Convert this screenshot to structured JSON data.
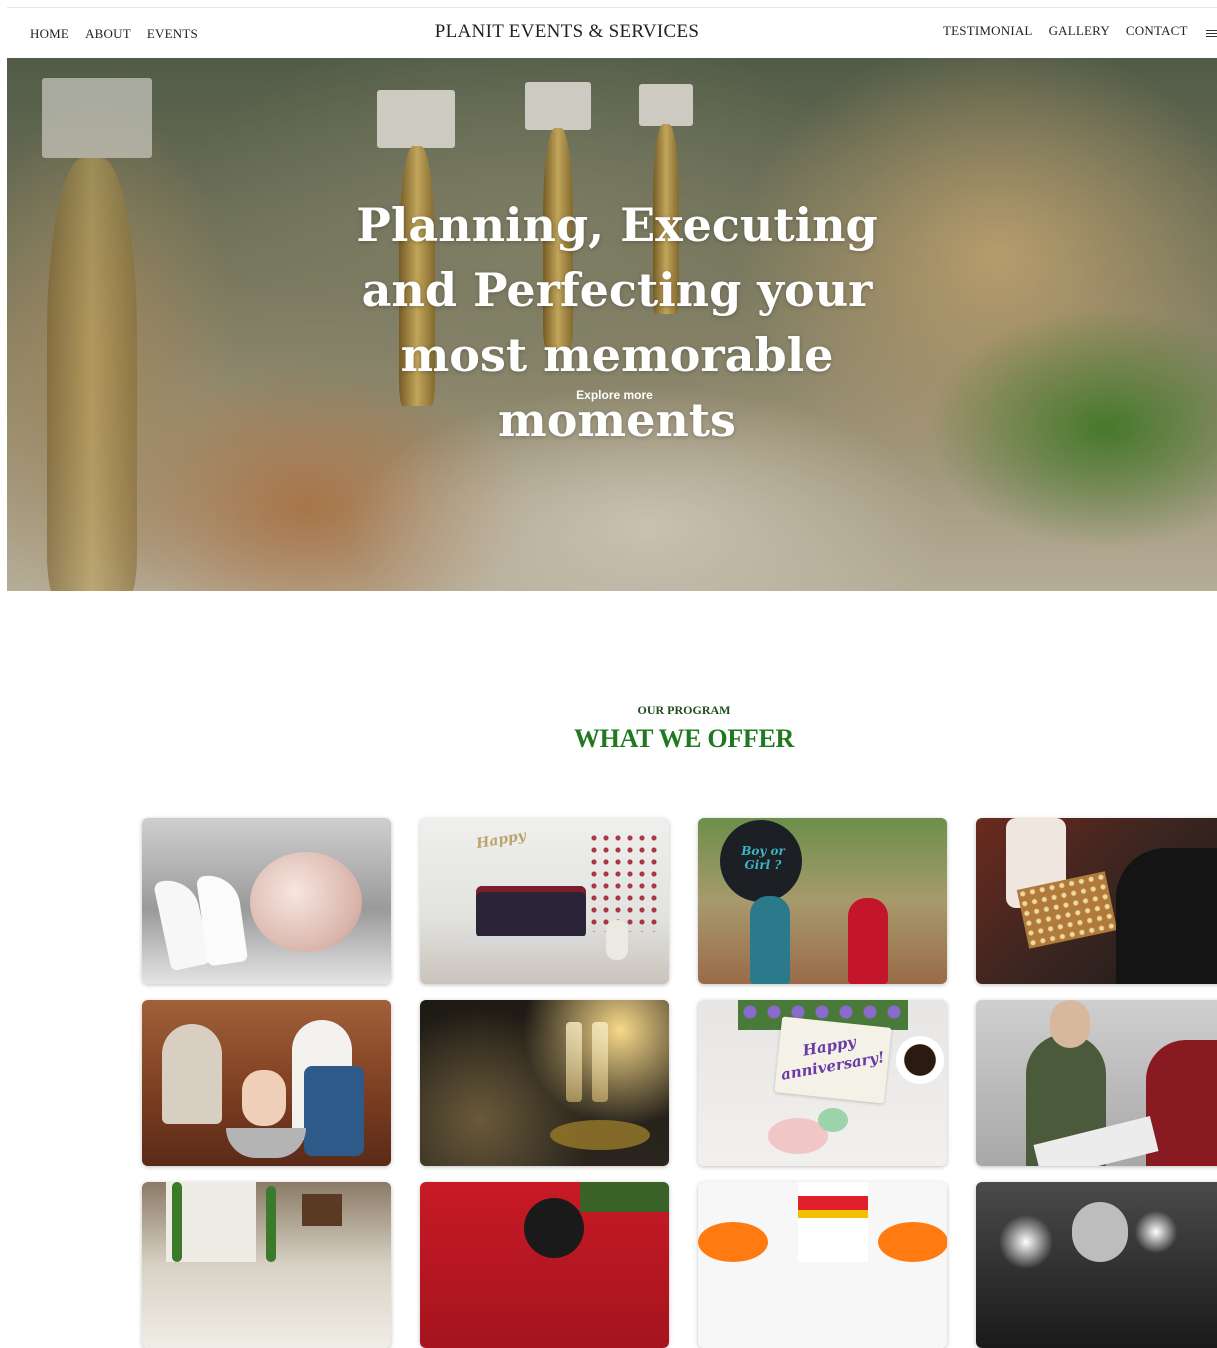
{
  "nav": {
    "brand": "PLANIT EVENTS & SERVICES",
    "left": [
      "HOME",
      "ABOUT",
      "EVENTS"
    ],
    "right": [
      "TESTIMONIAL",
      "GALLERY",
      "CONTACT"
    ],
    "menu_icon": "hamburger-menu-icon"
  },
  "hero": {
    "title": "Planning, Executing and Perfecting your most memorable moments",
    "cta": "Explore more"
  },
  "offer": {
    "kicker": "OUR PROGRAM",
    "heading": "WHAT WE OFFER"
  },
  "cards": [
    {
      "name": "wedding-shoes-bouquet"
    },
    {
      "name": "birthday-cake",
      "text": "Happy"
    },
    {
      "name": "gender-reveal",
      "text": "Boy or Girl ?"
    },
    {
      "name": "gift-exchange"
    },
    {
      "name": "baptism"
    },
    {
      "name": "champagne-toast"
    },
    {
      "name": "anniversary-card",
      "text": "Happy anniversary!"
    },
    {
      "name": "business-meeting"
    },
    {
      "name": "decor-backdrop"
    },
    {
      "name": "dog-party"
    },
    {
      "name": "cheerleaders"
    },
    {
      "name": "concert"
    }
  ],
  "colors": {
    "accent": "#1f7a1f",
    "kicker": "#1e4d1e"
  }
}
